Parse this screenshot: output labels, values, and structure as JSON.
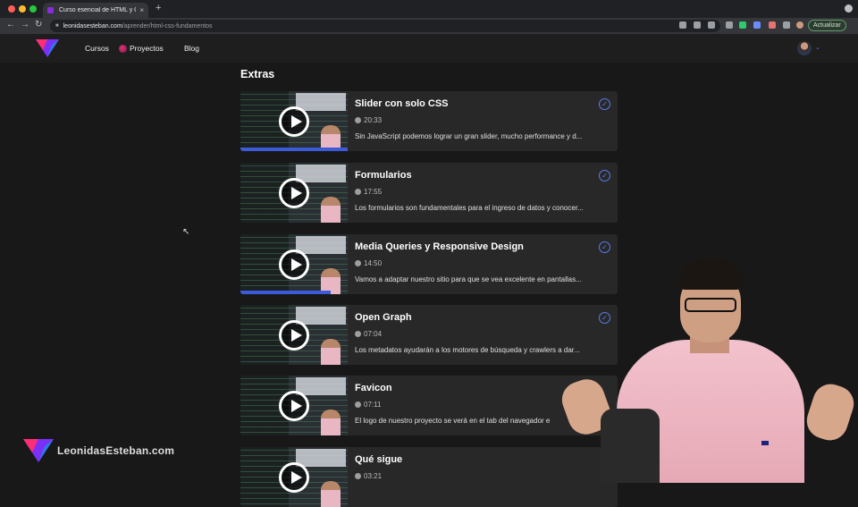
{
  "browser": {
    "tab_title": "Curso esencial de HTML y CSS",
    "tab_close": "×",
    "new_tab": "+",
    "url_domain": "leonidasesteban.com",
    "url_path": "/aprender/html-css-fundamentos",
    "update_label": "Actualizar",
    "back_icon": "←",
    "forward_icon": "→",
    "reload_icon": "↻"
  },
  "header": {
    "nav": [
      {
        "label": "Cursos"
      },
      {
        "label": "Proyectos"
      },
      {
        "label": "Blog"
      }
    ]
  },
  "section": {
    "title": "Extras"
  },
  "lessons": [
    {
      "title": "Slider con solo CSS",
      "duration": "20:33",
      "description": "Sin JavaScript podemos lograr un gran slider, mucho performance y d...",
      "completed": true,
      "progress": 1.0
    },
    {
      "title": "Formularios",
      "duration": "17:55",
      "description": "Los formularios son fundamentales para el ingreso de datos y conocer...",
      "completed": true,
      "progress": 0.0
    },
    {
      "title": "Media Queries y Responsive Design",
      "duration": "14:50",
      "description": "Vamos a adaptar nuestro sitio para que se vea excelente en pantallas...",
      "completed": true,
      "progress": 0.84
    },
    {
      "title": "Open Graph",
      "duration": "07:04",
      "description": "Los metadatos ayudarán a los motores de búsqueda y crawlers a dar...",
      "completed": true,
      "progress": 0.0
    },
    {
      "title": "Favicon",
      "duration": "07:11",
      "description": "El logo de nuestro proyecto se verá en el tab del navegador e",
      "completed": false,
      "progress": 0.0
    },
    {
      "title": "Qué sigue",
      "duration": "03:21",
      "description": "",
      "completed": false,
      "progress": 0.0
    }
  ],
  "watermark": {
    "text": "LeonidasEsteban.com"
  },
  "colors": {
    "accent": "#5b7cf0",
    "progress": "#3b5bdb",
    "card_bg": "#282828",
    "page_bg": "#181818"
  }
}
